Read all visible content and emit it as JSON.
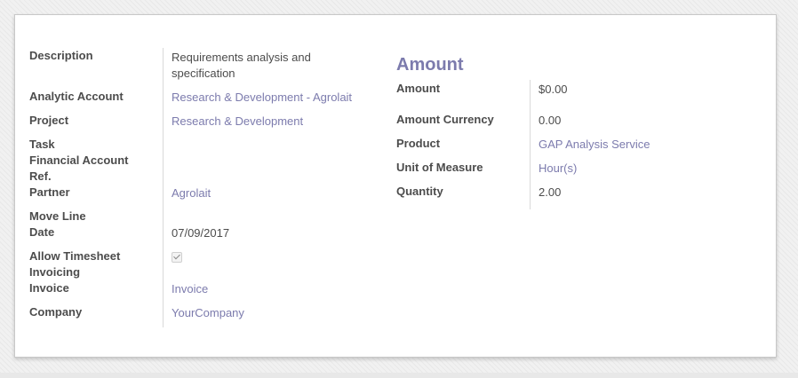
{
  "left": {
    "description_label": "Description",
    "description_value": "Requirements analysis and specification",
    "analytic_account_label": "Analytic Account",
    "analytic_account_value": "Research & Development - Agrolait",
    "project_label": "Project",
    "project_value": "Research & Development",
    "task_label": "Task",
    "task_value": "",
    "financial_account_label": "Financial Account",
    "financial_account_value": "",
    "ref_label": "Ref.",
    "ref_value": "",
    "partner_label": "Partner",
    "partner_value": "Agrolait",
    "move_line_label": "Move Line",
    "move_line_value": "",
    "date_label": "Date",
    "date_value": "07/09/2017",
    "allow_timesheet_label": "Allow Timesheet Invoicing",
    "allow_timesheet_checked": true,
    "invoice_label": "Invoice",
    "invoice_value": "Invoice",
    "company_label": "Company",
    "company_value": "YourCompany"
  },
  "right": {
    "title": "Amount",
    "amount_label": "Amount",
    "amount_value": "$0.00",
    "amount_currency_label": "Amount Currency",
    "amount_currency_value": "0.00",
    "product_label": "Product",
    "product_value": "GAP Analysis Service",
    "uom_label": "Unit of Measure",
    "uom_value": "Hour(s)",
    "quantity_label": "Quantity",
    "quantity_value": "2.00"
  },
  "colors": {
    "link": "#7c7bad",
    "text": "#4c4c4c"
  }
}
